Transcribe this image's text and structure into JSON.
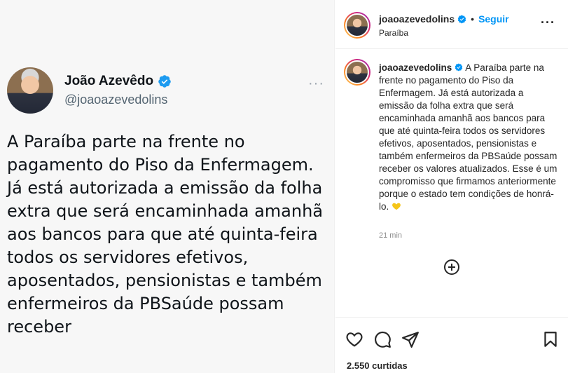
{
  "tweet": {
    "name": "João Azevêdo",
    "handle": "@joaoazevedolins",
    "more": "···",
    "text": "A Paraíba parte na frente no pagamento do Piso da Enfermagem. Já está autorizada a emissão da folha extra que será encaminhada amanhã aos bancos para que até quinta-feira todos os servidores efetivos, aposentados, pensionistas e também enfermeiros da PBSaúde possam receber"
  },
  "post": {
    "username": "joaoazevedolins",
    "separator": "•",
    "follow_label": "Seguir",
    "location": "Paraíba",
    "more": "···",
    "caption_text": "A Paraíba parte na frente no pagamento do Piso da Enfermagem. Já está autorizada a emissão da folha extra que será encaminhada amanhã aos bancos para que até quinta-feira todos os servidores efetivos, aposentados, pensionistas e também enfermeiros da PBSaúde possam receber os valores atualizados. Esse é um compromisso que firmamos anteriormente porque o estado tem condições de honrá-lo.",
    "time": "21 min",
    "likes": "2.550 curtidas"
  },
  "icons": {
    "verified": "verified-badge-icon",
    "heart": "heart-icon",
    "comment": "comment-icon",
    "share": "share-icon",
    "save": "bookmark-icon",
    "add": "add-comment-icon",
    "emoji": "yellow-heart-emoji"
  },
  "colors": {
    "accent": "#0095f6",
    "verified": "#0095f6",
    "twitter_verified": "#1d9bf0"
  }
}
